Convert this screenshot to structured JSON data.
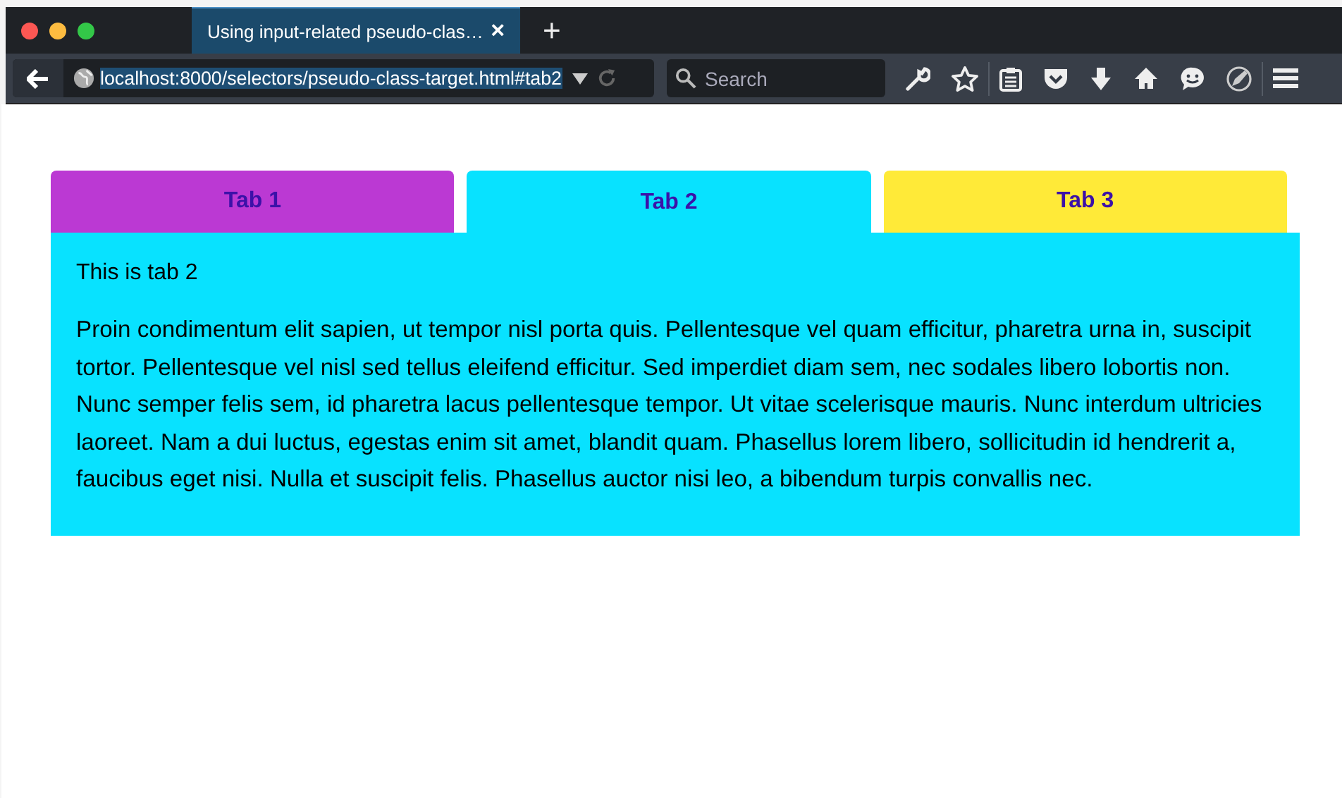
{
  "browser": {
    "tab_title": "Using input-related pseudo-clas…",
    "tab_close": "×",
    "new_tab": "+",
    "url": "localhost:8000/selectors/pseudo-class-target.html#tab2",
    "search": {
      "placeholder": "Search"
    }
  },
  "tabs": [
    {
      "label": "Tab 1",
      "selected": false,
      "color": "#bb39d3"
    },
    {
      "label": "Tab 2",
      "selected": true,
      "color": "#08e2ff"
    },
    {
      "label": "Tab 3",
      "selected": false,
      "color": "#ffea38"
    }
  ],
  "panel": {
    "heading": "This is tab 2",
    "body": "Proin condimentum elit sapien, ut tempor nisl porta quis. Pellentesque vel quam efficitur, pharetra urna in, suscipit tortor. Pellentesque vel nisl sed tellus eleifend efficitur. Sed imperdiet diam sem, nec sodales libero lobortis non. Nunc semper felis sem, id pharetra lacus pellentesque tempor. Ut vitae scelerisque mauris. Nunc interdum ultricies laoreet. Nam a dui luctus, egestas enim sit amet, blandit quam. Phasellus lorem libero, sollicitudin id hendrerit a, faucibus eget nisi. Nulla et suscipit felis. Phasellus auctor nisi leo, a bibendum turpis convallis nec."
  }
}
